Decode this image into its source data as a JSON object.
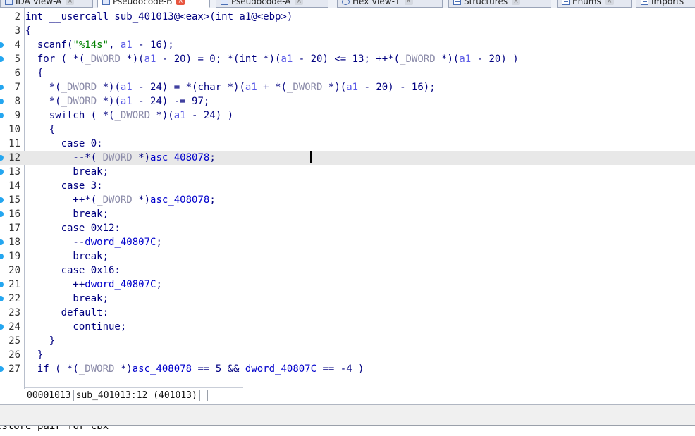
{
  "tabs": [
    {
      "label": "IDA View-A",
      "icon": "ida-view-icon",
      "active": false
    },
    {
      "label": "Pseudocode-B",
      "icon": "pseudocode-icon",
      "active": true
    },
    {
      "label": "Pseudocode-A",
      "icon": "pseudocode-icon",
      "active": false
    },
    {
      "label": "Hex View-1",
      "icon": "hex-view-icon",
      "active": false
    },
    {
      "label": "Structures",
      "icon": "structures-icon",
      "active": false
    },
    {
      "label": "Enums",
      "icon": "enums-icon",
      "active": false
    },
    {
      "label": "Imports",
      "icon": "imports-icon",
      "active": false
    }
  ],
  "code": {
    "lines": [
      {
        "num": "2",
        "bp": false,
        "tokens": [
          [
            "p",
            "int __usercall sub_401013@<eax>(int a1@<ebp>)"
          ]
        ]
      },
      {
        "num": "3",
        "bp": false,
        "tokens": [
          [
            "p",
            "{"
          ]
        ]
      },
      {
        "num": "4",
        "bp": true,
        "tokens": [
          [
            "p",
            "  scanf("
          ],
          [
            "n",
            "\"%14s\""
          ],
          [
            "p",
            ", "
          ],
          [
            "v",
            "a1"
          ],
          [
            "p",
            " - 16);"
          ]
        ]
      },
      {
        "num": "5",
        "bp": true,
        "tokens": [
          [
            "p",
            "  for ( *("
          ],
          [
            "t",
            "_DWORD"
          ],
          [
            "p",
            " *)("
          ],
          [
            "v",
            "a1"
          ],
          [
            "p",
            " - 20) = 0; *(int *)("
          ],
          [
            "v",
            "a1"
          ],
          [
            "p",
            " - 20) <= 13; ++*("
          ],
          [
            "t",
            "_DWORD"
          ],
          [
            "p",
            " *)("
          ],
          [
            "v",
            "a1"
          ],
          [
            "p",
            " - 20) )"
          ]
        ]
      },
      {
        "num": "6",
        "bp": false,
        "tokens": [
          [
            "p",
            "  {"
          ]
        ]
      },
      {
        "num": "7",
        "bp": true,
        "tokens": [
          [
            "p",
            "    *("
          ],
          [
            "t",
            "_DWORD"
          ],
          [
            "p",
            " *)("
          ],
          [
            "v",
            "a1"
          ],
          [
            "p",
            " - 24) = *(char *)("
          ],
          [
            "v",
            "a1"
          ],
          [
            "p",
            " + *("
          ],
          [
            "t",
            "_DWORD"
          ],
          [
            "p",
            " *)("
          ],
          [
            "v",
            "a1"
          ],
          [
            "p",
            " - 20) - 16);"
          ]
        ]
      },
      {
        "num": "8",
        "bp": true,
        "tokens": [
          [
            "p",
            "    *("
          ],
          [
            "t",
            "_DWORD"
          ],
          [
            "p",
            " *)("
          ],
          [
            "v",
            "a1"
          ],
          [
            "p",
            " - 24) -= 97;"
          ]
        ]
      },
      {
        "num": "9",
        "bp": true,
        "tokens": [
          [
            "p",
            "    switch ( *("
          ],
          [
            "t",
            "_DWORD"
          ],
          [
            "p",
            " *)("
          ],
          [
            "v",
            "a1"
          ],
          [
            "p",
            " - 24) )"
          ]
        ]
      },
      {
        "num": "10",
        "bp": false,
        "tokens": [
          [
            "p",
            "    {"
          ]
        ]
      },
      {
        "num": "11",
        "bp": false,
        "tokens": [
          [
            "p",
            "      case 0:"
          ]
        ]
      },
      {
        "num": "12",
        "bp": true,
        "current": true,
        "tokens": [
          [
            "p",
            "        --*("
          ],
          [
            "t",
            "_DWORD"
          ],
          [
            "p",
            " *)"
          ],
          [
            "g",
            "asc_408078"
          ],
          [
            "p",
            ";"
          ]
        ]
      },
      {
        "num": "13",
        "bp": true,
        "tokens": [
          [
            "p",
            "        break;"
          ]
        ]
      },
      {
        "num": "14",
        "bp": false,
        "tokens": [
          [
            "p",
            "      case 3:"
          ]
        ]
      },
      {
        "num": "15",
        "bp": true,
        "tokens": [
          [
            "p",
            "        ++*("
          ],
          [
            "t",
            "_DWORD"
          ],
          [
            "p",
            " *)"
          ],
          [
            "g",
            "asc_408078"
          ],
          [
            "p",
            ";"
          ]
        ]
      },
      {
        "num": "16",
        "bp": true,
        "tokens": [
          [
            "p",
            "        break;"
          ]
        ]
      },
      {
        "num": "17",
        "bp": false,
        "tokens": [
          [
            "p",
            "      case 0x12:"
          ]
        ]
      },
      {
        "num": "18",
        "bp": true,
        "tokens": [
          [
            "p",
            "        --"
          ],
          [
            "g",
            "dword_40807C"
          ],
          [
            "p",
            ";"
          ]
        ]
      },
      {
        "num": "19",
        "bp": true,
        "tokens": [
          [
            "p",
            "        break;"
          ]
        ]
      },
      {
        "num": "20",
        "bp": false,
        "tokens": [
          [
            "p",
            "      case 0x16:"
          ]
        ]
      },
      {
        "num": "21",
        "bp": true,
        "tokens": [
          [
            "p",
            "        ++"
          ],
          [
            "g",
            "dword_40807C"
          ],
          [
            "p",
            ";"
          ]
        ]
      },
      {
        "num": "22",
        "bp": true,
        "tokens": [
          [
            "p",
            "        break;"
          ]
        ]
      },
      {
        "num": "23",
        "bp": false,
        "tokens": [
          [
            "p",
            "      default:"
          ]
        ]
      },
      {
        "num": "24",
        "bp": true,
        "tokens": [
          [
            "p",
            "        continue;"
          ]
        ]
      },
      {
        "num": "25",
        "bp": false,
        "tokens": [
          [
            "p",
            "    }"
          ]
        ]
      },
      {
        "num": "26",
        "bp": false,
        "tokens": [
          [
            "p",
            "  }"
          ]
        ]
      },
      {
        "num": "27",
        "bp": true,
        "tokens": [
          [
            "p",
            "  if ( *("
          ],
          [
            "t",
            "_DWORD"
          ],
          [
            "p",
            " *)"
          ],
          [
            "g",
            "asc_408078"
          ],
          [
            "p",
            " == 5 && "
          ],
          [
            "g",
            "dword_40807C"
          ],
          [
            "p",
            " == -4 )"
          ]
        ]
      }
    ]
  },
  "status": {
    "address": "00001013",
    "location": "sub_401013:12 (401013)"
  },
  "output": {
    "text": "estore pair for cbx"
  },
  "colors": {
    "plain": "#000080",
    "variable": "#5a5ae6",
    "string": "#008000",
    "global": "#0000cc",
    "type": "#8a8aa8",
    "breakpoint_dot": "#24a6f0",
    "current_line": "#e8e8e8",
    "active_tab_close": "#e8553f"
  }
}
